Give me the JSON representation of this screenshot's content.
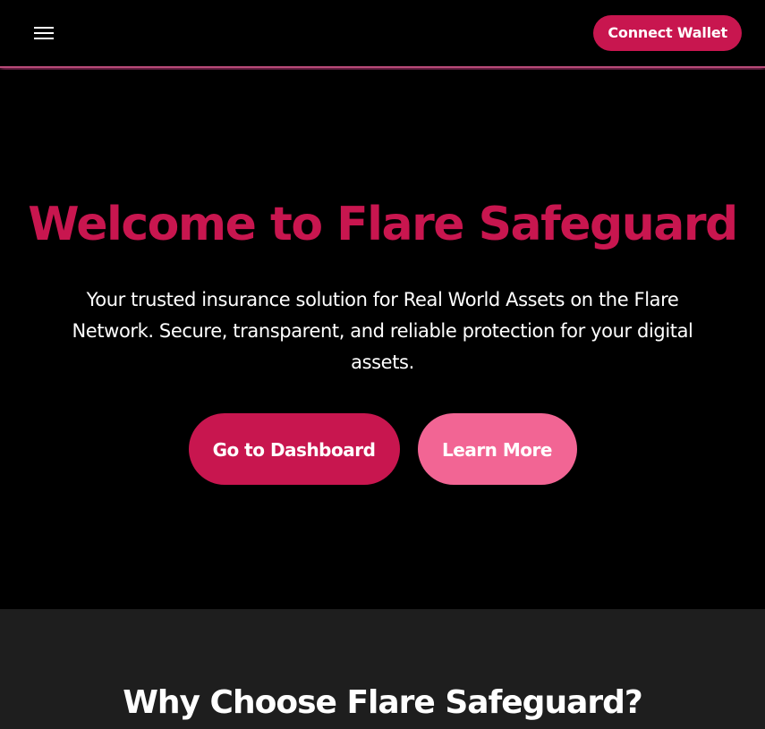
{
  "header": {
    "menu_icon": "hamburger-menu-icon",
    "connect_wallet_label": "Connect Wallet"
  },
  "hero": {
    "title": "Welcome to Flare Safeguard",
    "subtitle": "Your trusted insurance solution for Real World Assets on the Flare Network. Secure, transparent, and reliable protection for your digital assets.",
    "primary_button_label": "Go to Dashboard",
    "secondary_button_label": "Learn More"
  },
  "features": {
    "title": "Why Choose Flare Safeguard?"
  },
  "colors": {
    "accent": "#c8164f",
    "accent_light": "#f26594",
    "background": "#000000",
    "section_background": "#1e1e1e",
    "text": "#ffffff"
  }
}
